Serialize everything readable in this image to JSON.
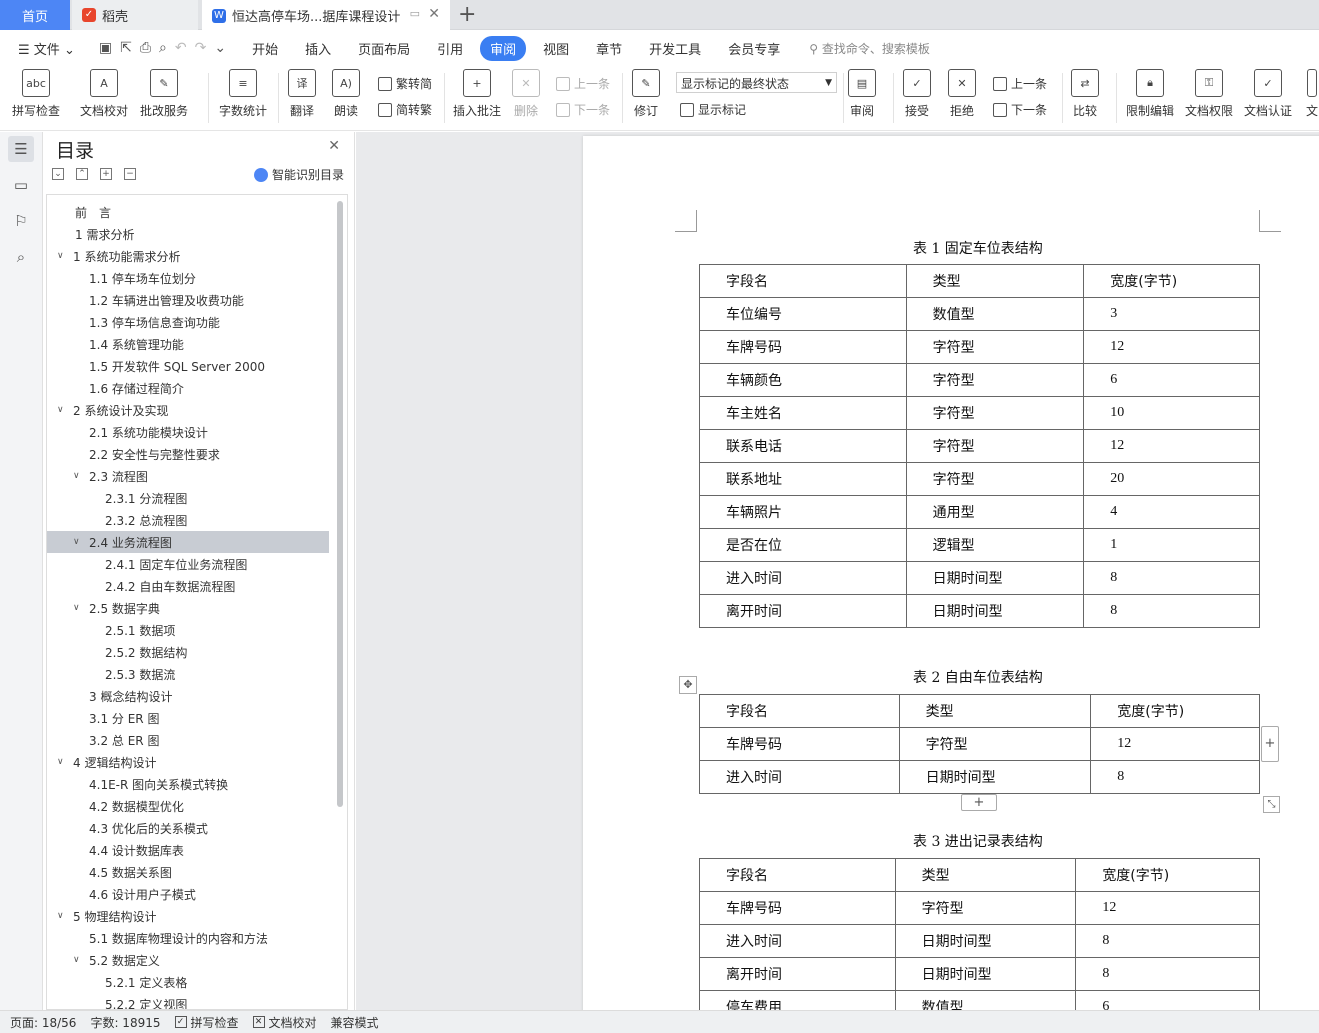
{
  "tabs": {
    "home": "首页",
    "daoke": "稻壳",
    "doc_title": "恒达高停车场...据库课程设计",
    "add": "+"
  },
  "menubar": {
    "file": "文件",
    "items": [
      "开始",
      "插入",
      "页面布局",
      "引用",
      "审阅",
      "视图",
      "章节",
      "开发工具",
      "会员专享"
    ],
    "active": "审阅",
    "search_placeholder": "查找命令、搜索模板"
  },
  "ribbon": {
    "spell_check": "拼写检查",
    "doc_proof": "文档校对",
    "batch_service": "批改服务",
    "word_count": "字数统计",
    "translate": "翻译",
    "read_aloud": "朗读",
    "trad_to_simp": "繁转简",
    "simp_to_trad": "简转繁",
    "insert_comment": "插入批注",
    "delete": "删除",
    "prev_comment": "上一条",
    "next_comment": "下一条",
    "revise": "修订",
    "markup_mode": "显示标记的最终状态",
    "show_markup": "显示标记",
    "review": "审阅",
    "accept": "接受",
    "reject": "拒绝",
    "prev_change": "上一条",
    "next_change": "下一条",
    "compare": "比较",
    "restrict_edit": "限制编辑",
    "doc_permission": "文档权限",
    "doc_cert": "文档认证",
    "doc_cut": "文"
  },
  "toc": {
    "title": "目录",
    "smart": "智能识别目录",
    "items": [
      {
        "text": "前　言",
        "level": 0,
        "caret": ""
      },
      {
        "text": "1 需求分析",
        "level": 0,
        "caret": ""
      },
      {
        "text": "1 系统功能需求分析",
        "level": 0,
        "caret": "v"
      },
      {
        "text": "1.1 停车场车位划分",
        "level": 1,
        "caret": ""
      },
      {
        "text": "1.2 车辆进出管理及收费功能",
        "level": 1,
        "caret": ""
      },
      {
        "text": "1.3 停车场信息查询功能",
        "level": 1,
        "caret": ""
      },
      {
        "text": "1.4 系统管理功能",
        "level": 1,
        "caret": ""
      },
      {
        "text": "1.5 开发软件 SQL Server 2000",
        "level": 1,
        "caret": ""
      },
      {
        "text": "1.6 存储过程简介",
        "level": 1,
        "caret": ""
      },
      {
        "text": "2 系统设计及实现",
        "level": 0,
        "caret": "v"
      },
      {
        "text": "2.1 系统功能模块设计",
        "level": 1,
        "caret": ""
      },
      {
        "text": "2.2 安全性与完整性要求",
        "level": 1,
        "caret": ""
      },
      {
        "text": "2.3 流程图",
        "level": 1,
        "caret": "v"
      },
      {
        "text": "2.3.1 分流程图",
        "level": 2,
        "caret": ""
      },
      {
        "text": "2.3.2 总流程图",
        "level": 2,
        "caret": ""
      },
      {
        "text": "2.4 业务流程图",
        "level": 1,
        "caret": "v",
        "selected": true
      },
      {
        "text": "2.4.1 固定车位业务流程图",
        "level": 2,
        "caret": ""
      },
      {
        "text": "2.4.2 自由车数据流程图",
        "level": 2,
        "caret": ""
      },
      {
        "text": "2.5 数据字典",
        "level": 1,
        "caret": "v"
      },
      {
        "text": "2.5.1 数据项",
        "level": 2,
        "caret": ""
      },
      {
        "text": "2.5.2 数据结构",
        "level": 2,
        "caret": ""
      },
      {
        "text": "2.5.3  数据流",
        "level": 2,
        "caret": ""
      },
      {
        "text": "3 概念结构设计",
        "level": 1,
        "caret": ""
      },
      {
        "text": "3.1 分 ER 图",
        "level": 1,
        "caret": ""
      },
      {
        "text": "3.2  总 ER 图",
        "level": 1,
        "caret": ""
      },
      {
        "text": "4 逻辑结构设计",
        "level": 0,
        "caret": "v"
      },
      {
        "text": "4.1E-R 图向关系模式转换",
        "level": 1,
        "caret": ""
      },
      {
        "text": "4.2 数据模型优化",
        "level": 1,
        "caret": ""
      },
      {
        "text": "4.3 优化后的关系模式",
        "level": 1,
        "caret": ""
      },
      {
        "text": "4.4 设计数据库表",
        "level": 1,
        "caret": ""
      },
      {
        "text": "4.5 数据关系图",
        "level": 1,
        "caret": ""
      },
      {
        "text": "4.6 设计用户子模式",
        "level": 1,
        "caret": ""
      },
      {
        "text": "5 物理结构设计",
        "level": 0,
        "caret": "v"
      },
      {
        "text": "5.1 数据库物理设计的内容和方法",
        "level": 1,
        "caret": ""
      },
      {
        "text": "5.2 数据定义",
        "level": 1,
        "caret": "v"
      },
      {
        "text": "5.2.1  定义表格",
        "level": 2,
        "caret": ""
      },
      {
        "text": "5.2.2  定义视图",
        "level": 2,
        "caret": ""
      }
    ]
  },
  "document": {
    "table1": {
      "caption": "表 1  固定车位表结构",
      "header": [
        "字段名",
        "类型",
        "宽度(字节)"
      ],
      "rows": [
        [
          "车位编号",
          "数值型",
          "3"
        ],
        [
          "车牌号码",
          "字符型",
          "12"
        ],
        [
          "车辆颜色",
          "字符型",
          "6"
        ],
        [
          "车主姓名",
          "字符型",
          "10"
        ],
        [
          "联系电话",
          "字符型",
          "12"
        ],
        [
          "联系地址",
          "字符型",
          "20"
        ],
        [
          "车辆照片",
          "通用型",
          "4"
        ],
        [
          "是否在位",
          "逻辑型",
          "1"
        ],
        [
          "进入时间",
          "日期时间型",
          "8"
        ],
        [
          "离开时间",
          "日期时间型",
          "8"
        ]
      ]
    },
    "table2": {
      "caption": "表 2  自由车位表结构",
      "header": [
        "字段名",
        "类型",
        "宽度(字节)"
      ],
      "rows": [
        [
          "车牌号码",
          "字符型",
          "12"
        ],
        [
          "进入时间",
          "日期时间型",
          "8"
        ]
      ]
    },
    "table3": {
      "caption": "表 3  进出记录表结构",
      "header": [
        "字段名",
        "类型",
        "宽度(字节)"
      ],
      "rows": [
        [
          "车牌号码",
          "字符型",
          "12"
        ],
        [
          "进入时间",
          "日期时间型",
          "8"
        ],
        [
          "离开时间",
          "日期时间型",
          "8"
        ],
        [
          "停车费用",
          "数值型",
          "6"
        ]
      ]
    }
  },
  "status": {
    "page": "页面: 18/56",
    "words": "字数: 18915",
    "spell": "拼写检查",
    "proof": "文档校对",
    "compat": "兼容模式"
  },
  "colors": {
    "accent": "#3a7ef2",
    "home_tab": "#4d86f5",
    "selected_toc": "#c8ccd3"
  }
}
